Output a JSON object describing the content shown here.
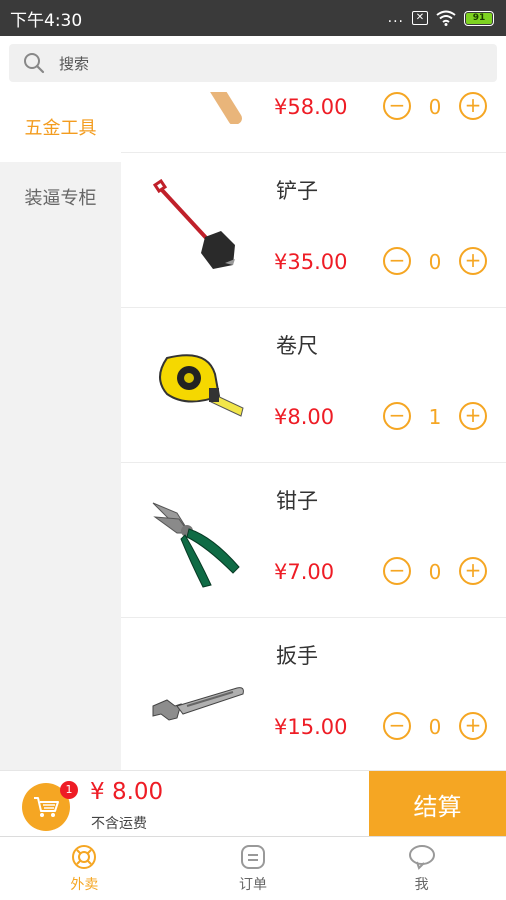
{
  "status_bar": {
    "time": "下午4:30",
    "dots": "...",
    "battery": "91"
  },
  "search": {
    "placeholder": "搜索"
  },
  "sidebar": {
    "items": [
      {
        "label": "五金工具",
        "active": true
      },
      {
        "label": "装逼专柜",
        "active": false
      }
    ]
  },
  "products": [
    {
      "name": "",
      "price": "¥58.00",
      "qty": "0",
      "icon": "hammer-image"
    },
    {
      "name": "铲子",
      "price": "¥35.00",
      "qty": "0",
      "icon": "shovel-image"
    },
    {
      "name": "卷尺",
      "price": "¥8.00",
      "qty": "1",
      "icon": "tape-measure-image"
    },
    {
      "name": "钳子",
      "price": "¥7.00",
      "qty": "0",
      "icon": "pliers-image"
    },
    {
      "name": "扳手",
      "price": "¥15.00",
      "qty": "0",
      "icon": "wrench-image"
    }
  ],
  "stepper": {
    "minus": "−",
    "plus": "+"
  },
  "cart": {
    "badge": "1",
    "total": "¥ 8.00",
    "note": "不含运费",
    "checkout_label": "结算"
  },
  "tabs": [
    {
      "label": "外卖",
      "active": true,
      "icon": "takeout-icon"
    },
    {
      "label": "订单",
      "active": false,
      "icon": "order-icon"
    },
    {
      "label": "我",
      "active": false,
      "icon": "profile-icon"
    }
  ],
  "colors": {
    "accent": "#f5a623",
    "price": "#ee1c25",
    "status_bar": "#3a3a3a"
  }
}
